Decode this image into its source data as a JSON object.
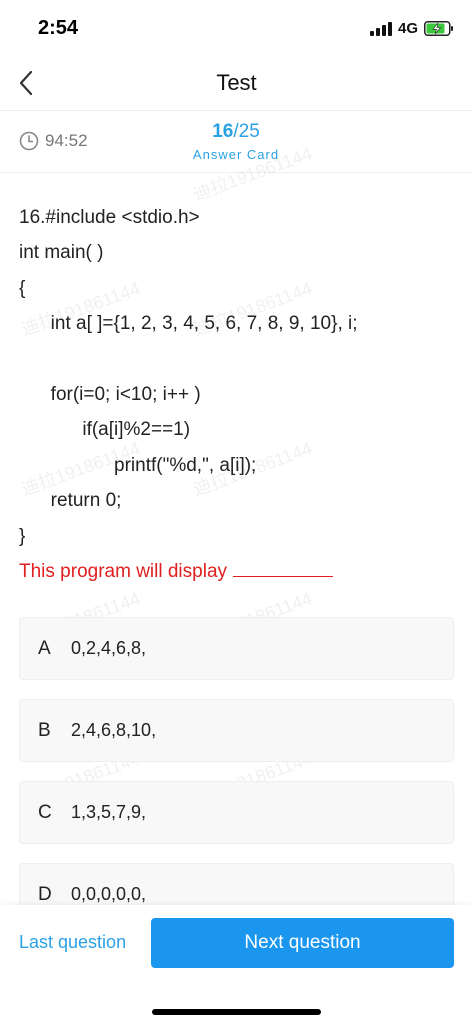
{
  "status_bar": {
    "time": "2:54",
    "network": "4G"
  },
  "nav": {
    "title": "Test"
  },
  "info": {
    "timer": "94:52",
    "current": "16",
    "separator": "/",
    "total": "25",
    "answer_card_label": "Answer Card"
  },
  "question": {
    "lines": [
      "16.#include <stdio.h>",
      "int main( )",
      "{",
      "      int a[ ]={1, 2, 3, 4, 5, 6, 7, 8, 9, 10}, i;",
      "",
      "      for(i=0; i<10; i++ )",
      "            if(a[i]%2==1)",
      "                  printf(\"%d,\", a[i]);",
      "      return 0;",
      "}"
    ],
    "prompt": "This program will display"
  },
  "options": [
    {
      "letter": "A",
      "text": "0,2,4,6,8,"
    },
    {
      "letter": "B",
      "text": "2,4,6,8,10,"
    },
    {
      "letter": "C",
      "text": "1,3,5,7,9,"
    },
    {
      "letter": "D",
      "text": "0,0,0,0,0,"
    }
  ],
  "watermark": "迪拉191861144",
  "buttons": {
    "last": "Last question",
    "next": "Next question"
  },
  "colors": {
    "accent": "#2aa1e3",
    "primary_button": "#1a96ef",
    "prompt": "#e02020"
  }
}
